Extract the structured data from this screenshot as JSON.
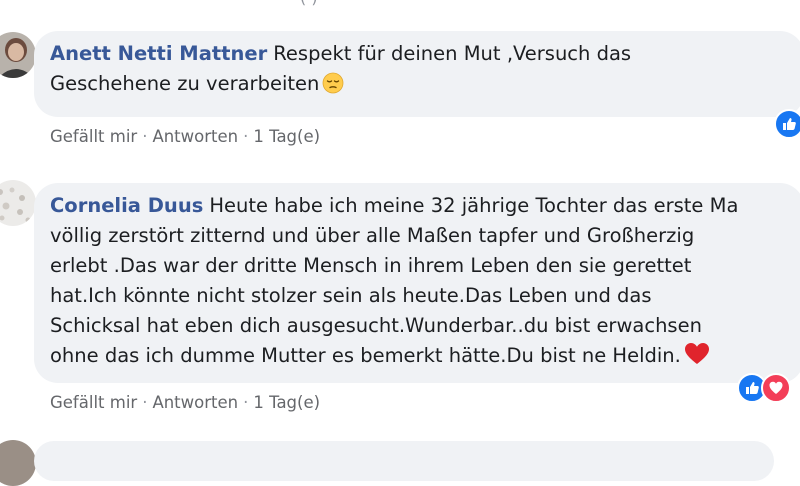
{
  "top_remnant": "(‧)",
  "comments": [
    {
      "author": "Anett Netti Mattner",
      "lines": [
        "Respekt für deinen Mut ‚Versuch das",
        "Geschehene zu verarbeiten"
      ],
      "emoji": "pensive-face",
      "actions": {
        "like": "Gefällt mir",
        "reply": "Antworten",
        "time": "1 Tag(e)"
      },
      "reactions": [
        "like"
      ]
    },
    {
      "author": "Cornelia Duus",
      "lines": [
        "Heute habe ich meine 32 jährige Tochter das erste Ma",
        "völlig zerstört zitternd und über alle Maßen tapfer und Großherzig",
        "erlebt .Das war der dritte Mensch in ihrem Leben den sie gerettet",
        "hat.Ich könnte nicht stolzer sein als heute.Das Leben und das",
        "Schicksal hat eben dich ausgesucht.Wunderbar..du bist erwachsen",
        "ohne das ich dumme Mutter es bemerkt hätte.Du bist ne Heldin."
      ],
      "emoji": "red-heart",
      "actions": {
        "like": "Gefällt mir",
        "reply": "Antworten",
        "time": "1 Tag(e)"
      },
      "reactions": [
        "like",
        "love"
      ]
    }
  ],
  "separator": "·",
  "colors": {
    "author": "#385898",
    "bubble": "#f0f2f5",
    "meta": "#65676b",
    "like": "#1877f2",
    "love": "#f33e58"
  }
}
